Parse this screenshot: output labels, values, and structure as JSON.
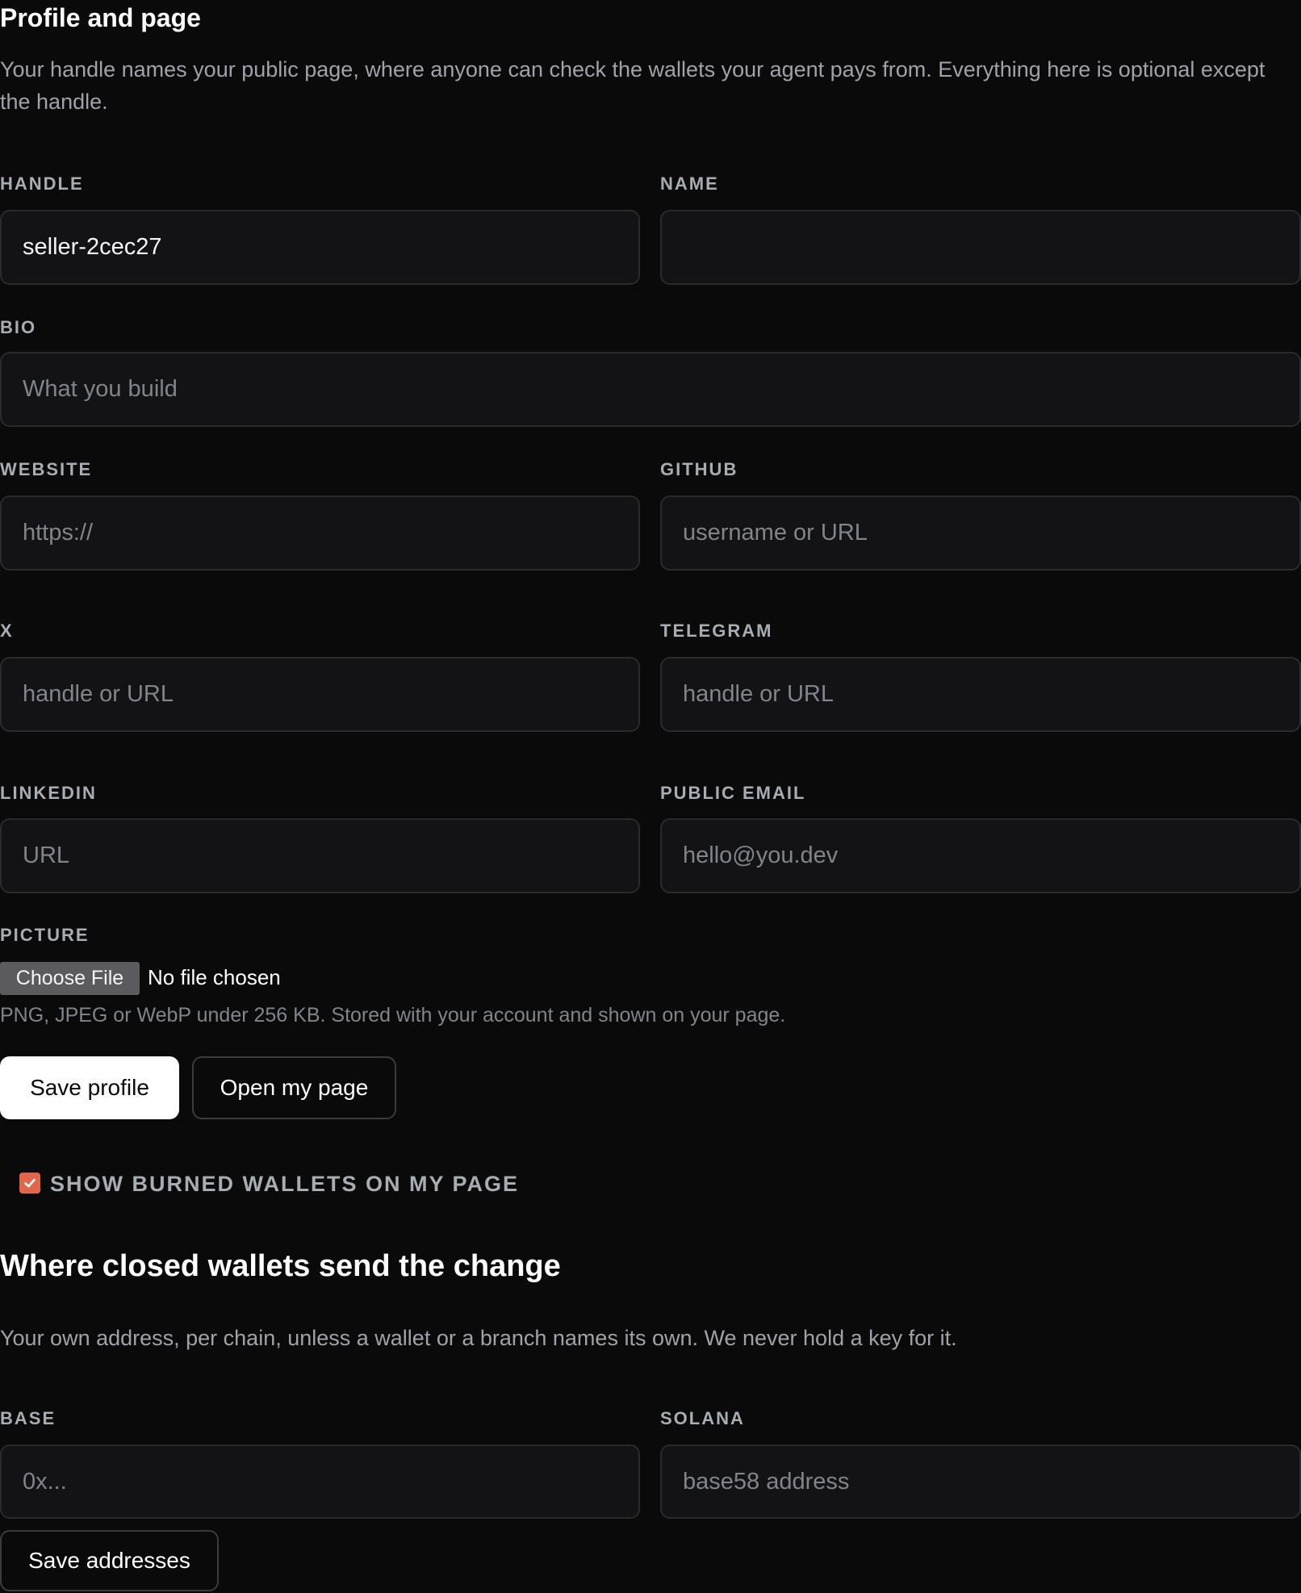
{
  "profile": {
    "title": "Profile and page",
    "description": "Your handle names your public page, where anyone can check the wallets your agent pays from. Everything here is optional except the handle.",
    "fields": {
      "handle": {
        "label": "HANDLE",
        "value": "seller-2cec27",
        "placeholder": ""
      },
      "name": {
        "label": "NAME",
        "value": "",
        "placeholder": ""
      },
      "bio": {
        "label": "BIO",
        "value": "",
        "placeholder": "What you build"
      },
      "website": {
        "label": "WEBSITE",
        "value": "",
        "placeholder": "https://"
      },
      "github": {
        "label": "GITHUB",
        "value": "",
        "placeholder": "username or URL"
      },
      "x": {
        "label": "X",
        "value": "",
        "placeholder": "handle or URL"
      },
      "telegram": {
        "label": "TELEGRAM",
        "value": "",
        "placeholder": "handle or URL"
      },
      "linkedin": {
        "label": "LINKEDIN",
        "value": "",
        "placeholder": "URL"
      },
      "public_email": {
        "label": "PUBLIC EMAIL",
        "value": "",
        "placeholder": "hello@you.dev"
      }
    },
    "picture": {
      "label": "PICTURE",
      "button_label": "Choose File",
      "status": "No file chosen",
      "hint": "PNG, JPEG or WebP under 256 KB. Stored with your account and shown on your page."
    },
    "actions": {
      "save_label": "Save profile",
      "open_label": "Open my page"
    },
    "burned_wallets": {
      "label": "SHOW BURNED WALLETS ON MY PAGE",
      "checked": true,
      "accent": "#e2674a"
    }
  },
  "change": {
    "title": "Where closed wallets send the change",
    "description": "Your own address, per chain, unless a wallet or a branch names its own. We never hold a key for it.",
    "fields": {
      "base": {
        "label": "BASE",
        "value": "",
        "placeholder": "0x..."
      },
      "solana": {
        "label": "SOLANA",
        "value": "",
        "placeholder": "base58 address"
      }
    },
    "save_label": "Save addresses"
  }
}
